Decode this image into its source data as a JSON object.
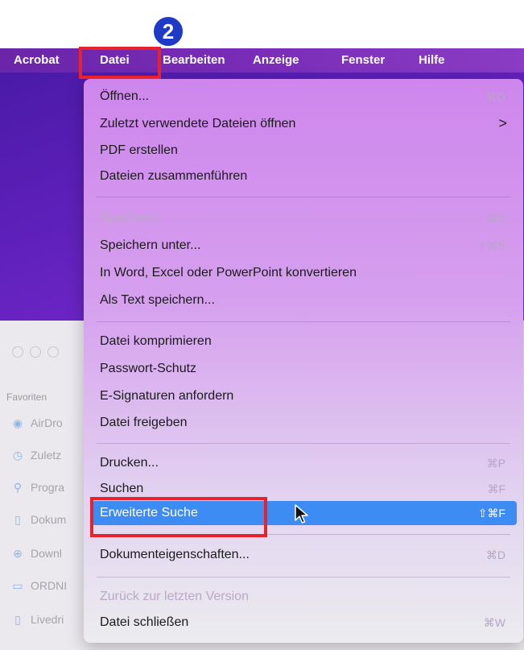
{
  "menubar": {
    "items": [
      "Acrobat",
      "Datei",
      "Bearbeiten",
      "Anzeige",
      "Fenster",
      "Hilfe"
    ]
  },
  "step_badge": "2",
  "menu": {
    "items": [
      {
        "label": "Öffnen...",
        "shortcut": "⌘O"
      },
      {
        "label": "Zuletzt verwendete Dateien öffnen",
        "submenu": ">"
      },
      {
        "label": "PDF erstellen"
      },
      {
        "label": "Dateien zusammenführen"
      },
      {
        "label": "Speichern",
        "shortcut": "⌘S",
        "disabled": true
      },
      {
        "label": "Speichern unter...",
        "shortcut": "⇧⌘S"
      },
      {
        "label": "In Word, Excel oder PowerPoint konvertieren"
      },
      {
        "label": "Als Text speichern..."
      },
      {
        "label": "Datei komprimieren"
      },
      {
        "label": "Passwort-Schutz"
      },
      {
        "label": "E-Signaturen anfordern"
      },
      {
        "label": "Datei freigeben"
      },
      {
        "label": "Drucken...",
        "shortcut": "⌘P"
      },
      {
        "label": "Suchen",
        "shortcut": "⌘F"
      },
      {
        "label": "Erweiterte Suche",
        "shortcut": "⇧⌘F",
        "highlighted": true
      },
      {
        "label": "Dokumenteigenschaften...",
        "shortcut": "⌘D"
      },
      {
        "label": "Zurück zur letzten Version",
        "disabled": true
      },
      {
        "label": "Datei schließen",
        "shortcut": "⌘W"
      }
    ]
  },
  "finder_sidebar": {
    "heading": "Favoriten",
    "items": [
      "AirDro",
      "Zuletz",
      "Progra",
      "Dokum",
      "Downl",
      "ORDNI",
      "Livedri"
    ]
  },
  "colors": {
    "highlight": "#3d8cf4",
    "callout": "#e8212a",
    "badge": "#1e3bc8"
  }
}
